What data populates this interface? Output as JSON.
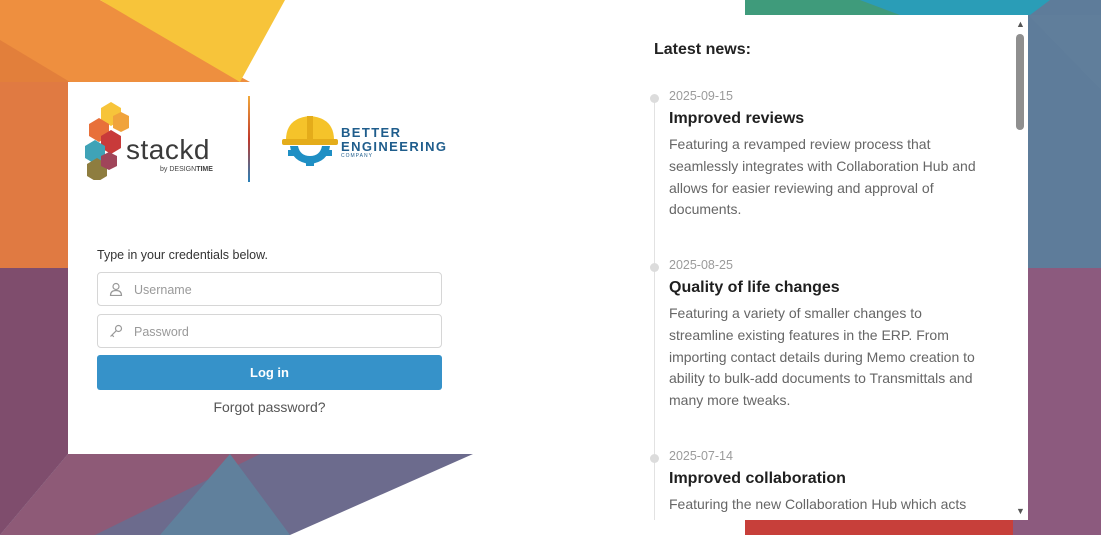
{
  "branding": {
    "stackd_word": "stackd",
    "byline_by": "by ",
    "byline_design": "DESIGN",
    "byline_time": "TIME",
    "be_line1": "BETTER",
    "be_line2": "ENGINEERING",
    "be_company": "COMPANY"
  },
  "login": {
    "instructions": "Type in your credentials below.",
    "username_placeholder": "Username",
    "password_placeholder": "Password",
    "login_label": "Log in",
    "forgot_label": "Forgot password?"
  },
  "news": {
    "title": "Latest news:",
    "items": [
      {
        "date": "2025-09-15",
        "headline": "Improved reviews",
        "description": "Featuring a revamped review process that seamlessly integrates with Collaboration Hub and allows for easier reviewing and approval of documents."
      },
      {
        "date": "2025-08-25",
        "headline": "Quality of life changes",
        "description": "Featuring a variety of smaller changes to streamline existing features in the ERP. From importing contact details during Memo creation to ability to bulk-add documents to Transmittals and many more tweaks."
      },
      {
        "date": "2025-07-14",
        "headline": "Improved collaboration",
        "description": "Featuring the new Collaboration Hub which acts as a central spot, email-server and Task"
      }
    ]
  },
  "colors": {
    "accent": "#3692c9",
    "brand_blue": "#1f5d8c"
  },
  "icons": {
    "username": "user-icon",
    "password": "key-icon",
    "scroll_up": "arrow-up-icon",
    "scroll_down": "arrow-down-icon"
  }
}
